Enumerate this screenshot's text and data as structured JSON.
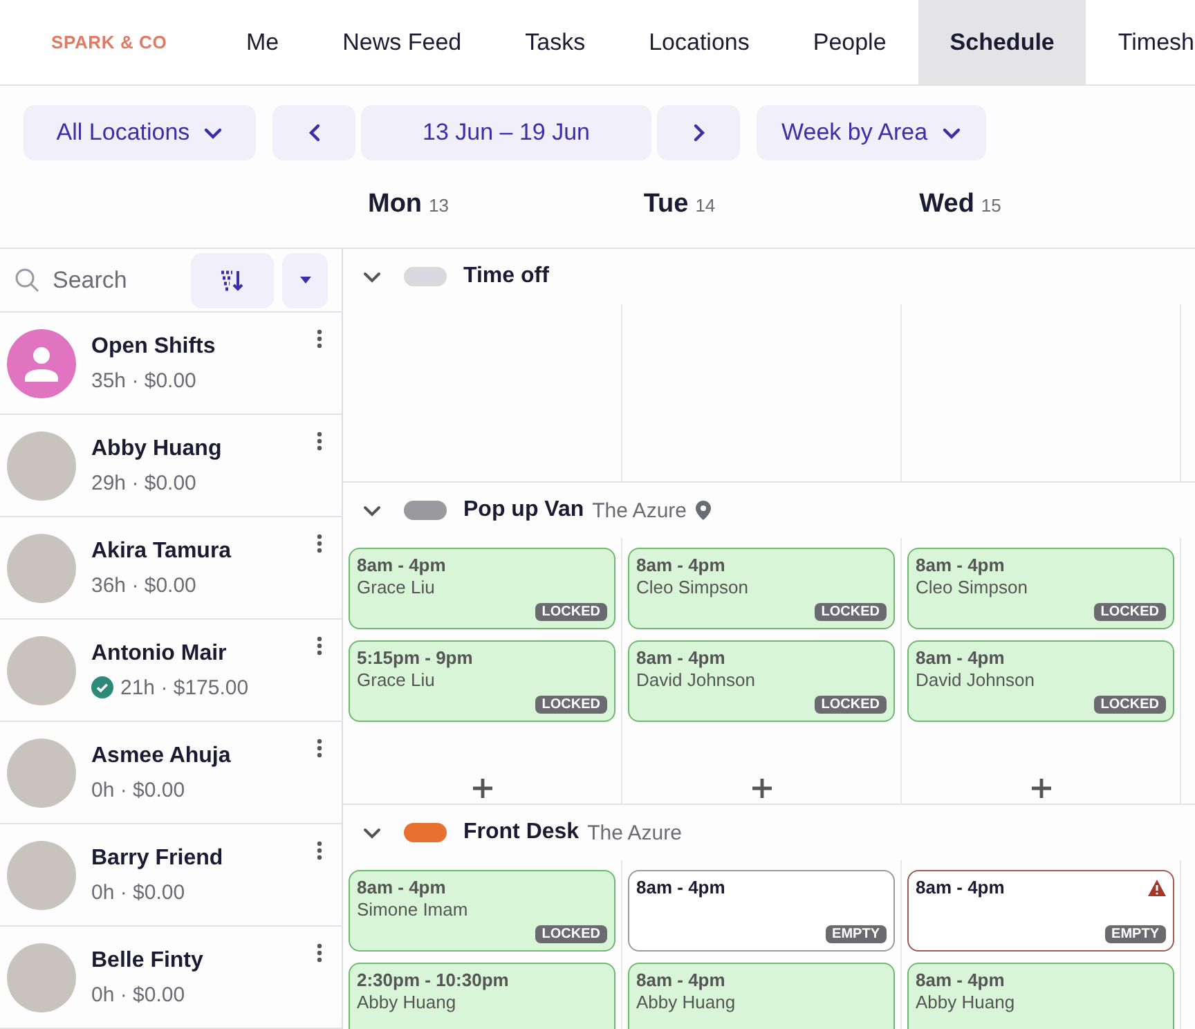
{
  "nav": {
    "logo": "SPARK & CO",
    "tabs": [
      {
        "label": "Me",
        "selected": false
      },
      {
        "label": "News Feed",
        "selected": false
      },
      {
        "label": "Tasks",
        "selected": false
      },
      {
        "label": "Locations",
        "selected": false
      },
      {
        "label": "People",
        "selected": false
      },
      {
        "label": "Schedule",
        "selected": true
      },
      {
        "label": "Timesh",
        "selected": false
      }
    ]
  },
  "toolbar": {
    "location_filter": "All Locations",
    "date_range": "13 Jun – 19 Jun",
    "view": "Week by Area"
  },
  "days": [
    {
      "name": "Mon",
      "date": "13"
    },
    {
      "name": "Tue",
      "date": "14"
    },
    {
      "name": "Wed",
      "date": "15"
    }
  ],
  "sidebar": {
    "search": {
      "placeholder": "Search"
    },
    "people": [
      {
        "kind": "open",
        "name": "Open Shifts",
        "summary": "35h · $0.00",
        "approved": false
      },
      {
        "kind": "person",
        "name": "Abby Huang",
        "summary": "29h · $0.00",
        "approved": false
      },
      {
        "kind": "person",
        "name": "Akira Tamura",
        "summary": "36h · $0.00",
        "approved": false
      },
      {
        "kind": "person",
        "name": "Antonio Mair",
        "summary": "21h · $175.00",
        "approved": true
      },
      {
        "kind": "person",
        "name": "Asmee Ahuja",
        "summary": "0h · $0.00",
        "approved": false
      },
      {
        "kind": "person",
        "name": "Barry Friend",
        "summary": "0h · $0.00",
        "approved": false
      },
      {
        "kind": "person",
        "name": "Belle Finty",
        "summary": "0h · $0.00",
        "approved": false
      }
    ]
  },
  "areas": [
    {
      "name": "Time off",
      "color": "#d9d8de",
      "expanded": true
    },
    {
      "name": "Pop up Van",
      "location": "The Azure",
      "pin": true,
      "color": "#9a999e",
      "expanded": true,
      "add_button": true,
      "days": [
        [
          {
            "kind": "assigned",
            "time": "8am - 4pm",
            "employee": "Grace Liu",
            "badge": "LOCKED"
          },
          {
            "kind": "assigned",
            "time": "5:15pm - 9pm",
            "employee": "Grace Liu",
            "badge": "LOCKED"
          }
        ],
        [
          {
            "kind": "assigned",
            "time": "8am - 4pm",
            "employee": "Cleo Simpson",
            "badge": "LOCKED"
          },
          {
            "kind": "assigned",
            "time": "8am - 4pm",
            "employee": "David Johnson",
            "badge": "LOCKED"
          }
        ],
        [
          {
            "kind": "assigned",
            "time": "8am - 4pm",
            "employee": "Cleo Simpson",
            "badge": "LOCKED"
          },
          {
            "kind": "assigned",
            "time": "8am - 4pm",
            "employee": "David Johnson",
            "badge": "LOCKED"
          }
        ]
      ]
    },
    {
      "name": "Front Desk",
      "location": "The Azure",
      "color": "#e8712f",
      "expanded": true,
      "days": [
        [
          {
            "kind": "assigned",
            "time": "8am - 4pm",
            "employee": "Simone Imam",
            "badge": "LOCKED"
          },
          {
            "kind": "assigned",
            "time": "2:30pm - 10:30pm",
            "employee": "Abby Huang"
          }
        ],
        [
          {
            "kind": "empty",
            "time": "8am - 4pm",
            "badge": "EMPTY"
          },
          {
            "kind": "assigned",
            "time": "8am - 4pm",
            "employee": "Abby Huang"
          }
        ],
        [
          {
            "kind": "warning",
            "time": "8am - 4pm",
            "badge": "EMPTY"
          },
          {
            "kind": "assigned",
            "time": "8am - 4pm",
            "employee": "Abby Huang"
          }
        ]
      ]
    }
  ]
}
